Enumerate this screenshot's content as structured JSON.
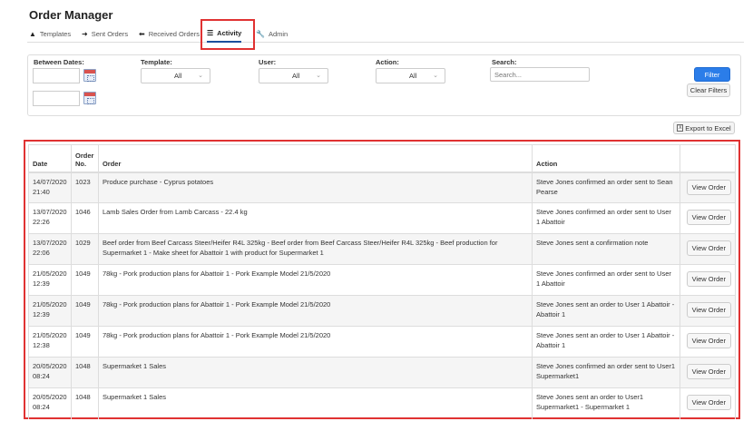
{
  "app": {
    "title": "Order Manager"
  },
  "nav": {
    "tabs": [
      {
        "label": "Templates",
        "icon": "hat-icon"
      },
      {
        "label": "Sent Orders",
        "icon": "arrow-right-icon"
      },
      {
        "label": "Received Orders",
        "icon": "arrow-left-icon"
      },
      {
        "label": "Activity",
        "icon": "list-icon",
        "active": true
      },
      {
        "label": "Admin",
        "icon": "wrench-icon"
      }
    ]
  },
  "filters": {
    "between_dates_label": "Between Dates:",
    "template_label": "Template:",
    "template_value": "All",
    "user_label": "User:",
    "user_value": "All",
    "action_label": "Action:",
    "action_value": "All",
    "search_label": "Search:",
    "search_placeholder": "Search...",
    "filter_button": "Filter",
    "clear_button": "Clear Filters",
    "export_button": "Export to Excel"
  },
  "table": {
    "headers": {
      "date": "Date",
      "order_no": "Order No.",
      "order": "Order",
      "action": "Action"
    },
    "view_button_label": "View Order",
    "rows": [
      {
        "date": "14/07/2020 21:40",
        "order_no": "1023",
        "order": "Produce purchase - Cyprus potatoes",
        "action": "Steve Jones confirmed an order sent to Sean Pearse"
      },
      {
        "date": "13/07/2020 22:26",
        "order_no": "1046",
        "order": "Lamb Sales Order from Lamb Carcass - 22.4 kg",
        "action": "Steve Jones confirmed an order sent to User 1 Abattoir"
      },
      {
        "date": "13/07/2020 22:06",
        "order_no": "1029",
        "order": "Beef order from Beef Carcass Steer/Heifer R4L 325kg - Beef order from Beef Carcass Steer/Heifer R4L 325kg - Beef production for Supermarket 1 - Make sheet for Abattoir 1 with product for Supermarket 1",
        "action": "Steve Jones sent a confirmation note"
      },
      {
        "date": "21/05/2020 12:39",
        "order_no": "1049",
        "order": "78kg - Pork production plans for Abattoir 1 - Pork Example Model 21/5/2020",
        "action": "Steve Jones confirmed an order sent to User 1 Abattoir"
      },
      {
        "date": "21/05/2020 12:39",
        "order_no": "1049",
        "order": "78kg - Pork production plans for Abattoir 1 - Pork Example Model 21/5/2020",
        "action": "Steve Jones sent an order to User 1 Abattoir - Abattoir 1"
      },
      {
        "date": "21/05/2020 12:38",
        "order_no": "1049",
        "order": "78kg - Pork production plans for Abattoir 1 - Pork Example Model 21/5/2020",
        "action": "Steve Jones sent an order to User 1 Abattoir - Abattoir 1"
      },
      {
        "date": "20/05/2020 08:24",
        "order_no": "1048",
        "order": "Supermarket 1 Sales",
        "action": "Steve Jones confirmed an order sent to User1 Supermarket1"
      },
      {
        "date": "20/05/2020 08:24",
        "order_no": "1048",
        "order": "Supermarket 1 Sales",
        "action": "Steve Jones sent an order to User1 Supermarket1 - Supermarket 1"
      }
    ]
  },
  "colors": {
    "highlight": "#e03232",
    "primary_button": "#2b7de9"
  }
}
